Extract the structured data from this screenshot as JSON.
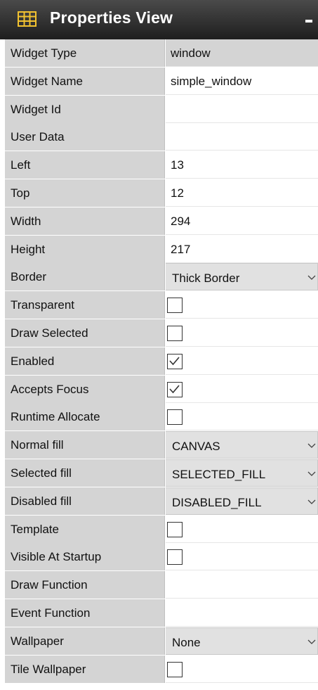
{
  "window": {
    "title": "Properties View",
    "icon": "table-grid-icon",
    "minimize_icon": "minimize-icon"
  },
  "colors": {
    "titlebar": "#2e2e2e",
    "label_bg": "#d4d4d4",
    "dropdown_bg": "#e1e1e1",
    "icon_yellow": "#f2c230"
  },
  "properties": [
    {
      "label": "Widget Type",
      "kind": "readonly",
      "value": "window"
    },
    {
      "label": "Widget Name",
      "kind": "text",
      "value": "simple_window"
    },
    {
      "label": "Widget Id",
      "kind": "text",
      "value": ""
    },
    {
      "label": "User Data",
      "kind": "text",
      "value": ""
    },
    {
      "label": "Left",
      "kind": "text",
      "value": "13"
    },
    {
      "label": "Top",
      "kind": "text",
      "value": "12"
    },
    {
      "label": "Width",
      "kind": "text",
      "value": "294"
    },
    {
      "label": "Height",
      "kind": "text",
      "value": "217"
    },
    {
      "label": "Border",
      "kind": "select",
      "value": "Thick Border"
    },
    {
      "label": "Transparent",
      "kind": "checkbox",
      "checked": false
    },
    {
      "label": "Draw Selected",
      "kind": "checkbox",
      "checked": false
    },
    {
      "label": "Enabled",
      "kind": "checkbox",
      "checked": true
    },
    {
      "label": "Accepts Focus",
      "kind": "checkbox",
      "checked": true
    },
    {
      "label": "Runtime Allocate",
      "kind": "checkbox",
      "checked": false
    },
    {
      "label": "Normal fill",
      "kind": "select",
      "value": "CANVAS"
    },
    {
      "label": "Selected fill",
      "kind": "select",
      "value": "SELECTED_FILL"
    },
    {
      "label": "Disabled fill",
      "kind": "select",
      "value": "DISABLED_FILL"
    },
    {
      "label": "Template",
      "kind": "checkbox",
      "checked": false
    },
    {
      "label": "Visible At Startup",
      "kind": "checkbox",
      "checked": false
    },
    {
      "label": "Draw Function",
      "kind": "text",
      "value": ""
    },
    {
      "label": "Event Function",
      "kind": "text",
      "value": ""
    },
    {
      "label": "Wallpaper",
      "kind": "select",
      "value": "None"
    },
    {
      "label": "Tile Wallpaper",
      "kind": "checkbox",
      "checked": false
    }
  ]
}
